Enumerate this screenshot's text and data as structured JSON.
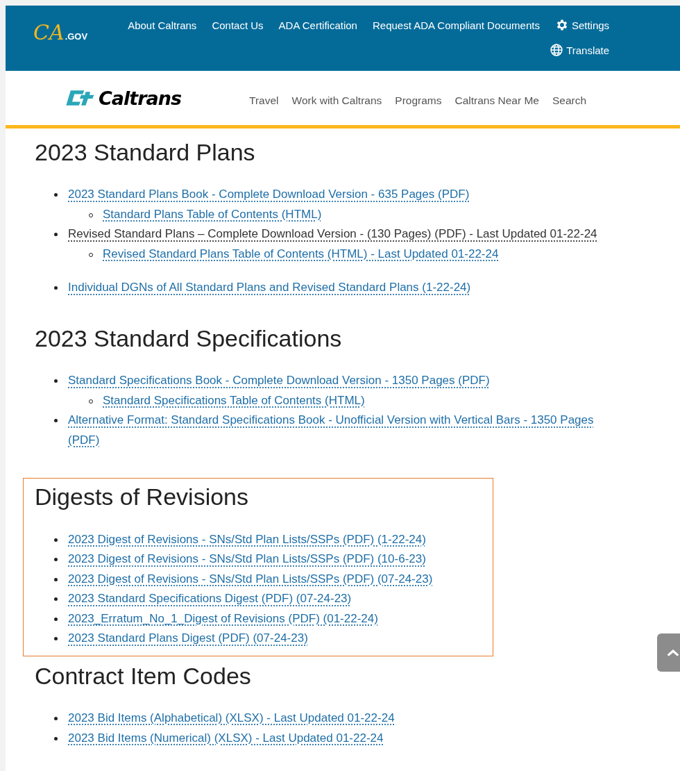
{
  "header": {
    "logo": {
      "mark": "CA",
      "suffix": ".GOV"
    },
    "utility_links": [
      "About Caltrans",
      "Contact Us",
      "ADA Certification",
      "Request ADA Compliant Documents"
    ],
    "settings": "Settings",
    "translate": "Translate"
  },
  "brand": {
    "name": "Caltrans"
  },
  "nav": [
    "Travel",
    "Work with Caltrans",
    "Programs",
    "Caltrans Near Me",
    "Search"
  ],
  "sections": [
    {
      "title": "2023 Standard Plans",
      "highlighted": false,
      "items": [
        {
          "text": "2023 Standard Plans Book - Complete Download Version - 635 Pages (PDF)",
          "kind": "link",
          "children": [
            {
              "text": "Standard Plans Table of Contents (HTML)",
              "kind": "link"
            }
          ]
        },
        {
          "text": "Revised Standard Plans – Complete Download Version -  (130 Pages) (PDF) -  Last Updated 01-22-24",
          "kind": "plain",
          "children": [
            {
              "text": "Revised Standard Plans Table of Contents (HTML) -  Last Updated 01-22-24",
              "kind": "link"
            }
          ]
        },
        {
          "text": "Individual DGNs of All Standard Plans and Revised Standard Plans (1-22-24)",
          "kind": "link"
        }
      ]
    },
    {
      "title": "2023 Standard Specifications",
      "highlighted": false,
      "items": [
        {
          "text": "Standard Specifications Book - Complete Download Version - 1350 Pages (PDF)",
          "kind": "link",
          "children": [
            {
              "text": "Standard Specifications Table of Contents (HTML)",
              "kind": "link"
            }
          ]
        },
        {
          "text": "Alternative Format: Standard Specifications Book - Unofficial Version with Vertical Bars - 1350 Pages (PDF)",
          "kind": "link"
        }
      ]
    },
    {
      "title": "Digests of Revisions",
      "highlighted": true,
      "items": [
        {
          "text": "2023 Digest of Revisions - SNs/Std Plan Lists/SSPs (PDF) (1-22-24)",
          "kind": "link"
        },
        {
          "text": "2023 Digest of Revisions - SNs/Std Plan Lists/SSPs (PDF) (10-6-23)",
          "kind": "link"
        },
        {
          "text": "2023 Digest of Revisions - SNs/Std Plan Lists/SSPs (PDF) (07-24-23)",
          "kind": "link"
        },
        {
          "text": "2023 Standard Specifications Digest (PDF) (07-24-23)",
          "kind": "link"
        },
        {
          "text": "2023_Erratum_No_1_Digest of Revisions (PDF) (01-22-24)",
          "kind": "link"
        },
        {
          "text": "2023 Standard Plans Digest (PDF) (07-24-23)",
          "kind": "link"
        }
      ]
    },
    {
      "title": "Contract Item Codes",
      "highlighted": false,
      "items": [
        {
          "text": "2023 Bid Items (Alphabetical) (XLSX) - Last Updated 01-22-24",
          "kind": "link"
        },
        {
          "text": "2023 Bid Items (Numerical) (XLSX) - Last Updated 01-22-24",
          "kind": "link"
        }
      ]
    }
  ]
}
